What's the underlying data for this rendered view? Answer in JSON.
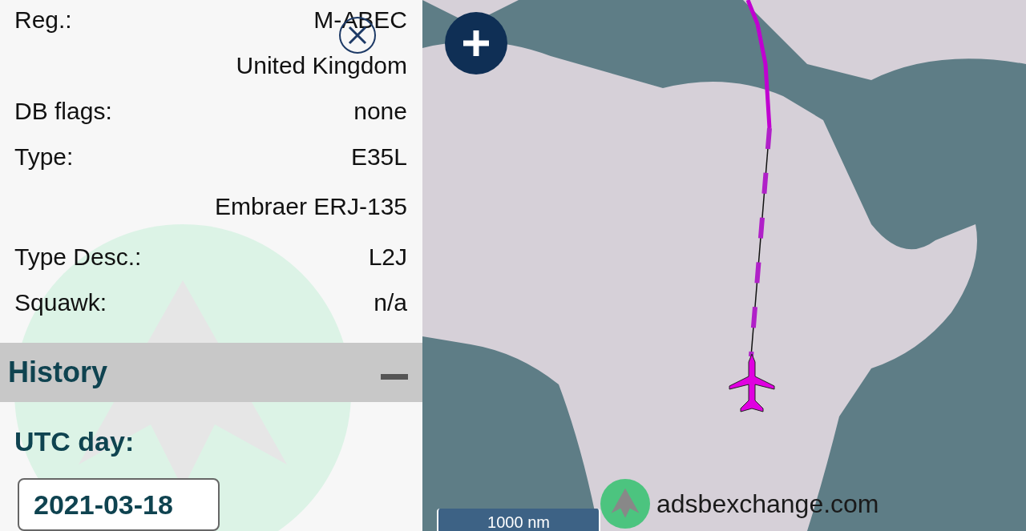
{
  "details": [
    {
      "label": "Reg.:",
      "value": "M-ABEC"
    },
    {
      "value": "United Kingdom"
    },
    {
      "label": "DB flags:",
      "value": "none"
    },
    {
      "label": "Type:",
      "value": "E35L"
    },
    {
      "value": "Embraer ERJ-135"
    },
    {
      "label": "Type Desc.:",
      "value": "L2J"
    },
    {
      "label": "Squawk:",
      "value": "n/a"
    }
  ],
  "history": {
    "title": "History",
    "expanded": true,
    "utc_day_label": "UTC day:",
    "utc_day": "2021-03-18"
  },
  "map": {
    "scale": "1000 nm",
    "brand": "adsbexchange.com"
  }
}
